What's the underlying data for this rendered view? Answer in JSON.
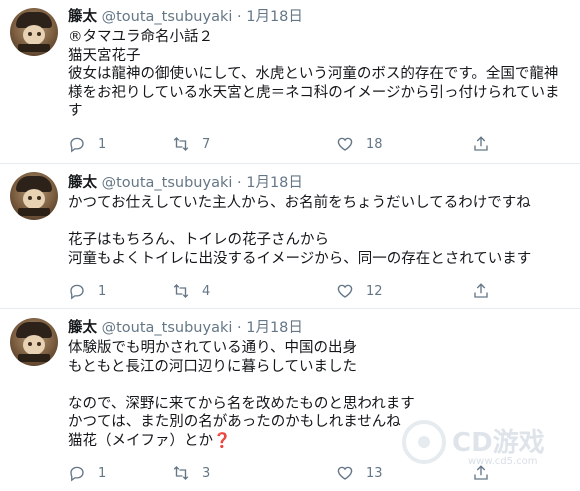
{
  "tweets": [
    {
      "name": "籐太",
      "handle": "@touta_tsubuyaki",
      "dot": "·",
      "time": "1月18日",
      "text": "®タマユラ命名小話２\n猫天宮花子\n彼女は龍神の御使いにして、水虎という河童のボス的存在です。全国で龍神様をお祀りしている水天宮と虎＝ネコ科のイメージから引っ付けられています",
      "replies": "1",
      "retweets": "7",
      "likes": "18"
    },
    {
      "name": "籐太",
      "handle": "@touta_tsubuyaki",
      "dot": "·",
      "time": "1月18日",
      "text": "かつてお仕えしていた主人から、お名前をちょうだいしてるわけですね\n\n花子はもちろん、トイレの花子さんから\n河童もよくトイレに出没するイメージから、同一の存在とされています",
      "replies": "1",
      "retweets": "4",
      "likes": "12"
    },
    {
      "name": "籐太",
      "handle": "@touta_tsubuyaki",
      "dot": "·",
      "time": "1月18日",
      "text": "体験版でも明かされている通り、中国の出身\nもともと長江の河口辺りに暮らしていました\n\nなので、深野に来てから名を改めたものと思われます\nかつては、また別の名があったのかもしれませんね\n猫花（メイファ）とか❓",
      "replies": "1",
      "retweets": "3",
      "likes": "13"
    }
  ],
  "watermark": {
    "text": "CD游戏",
    "url": "www.cd5.com"
  },
  "colors": {
    "text": "#14171a",
    "muted": "#657786",
    "divider": "#e6ecf0"
  },
  "icons": [
    "reply-icon",
    "retweet-icon",
    "like-icon",
    "share-icon"
  ]
}
